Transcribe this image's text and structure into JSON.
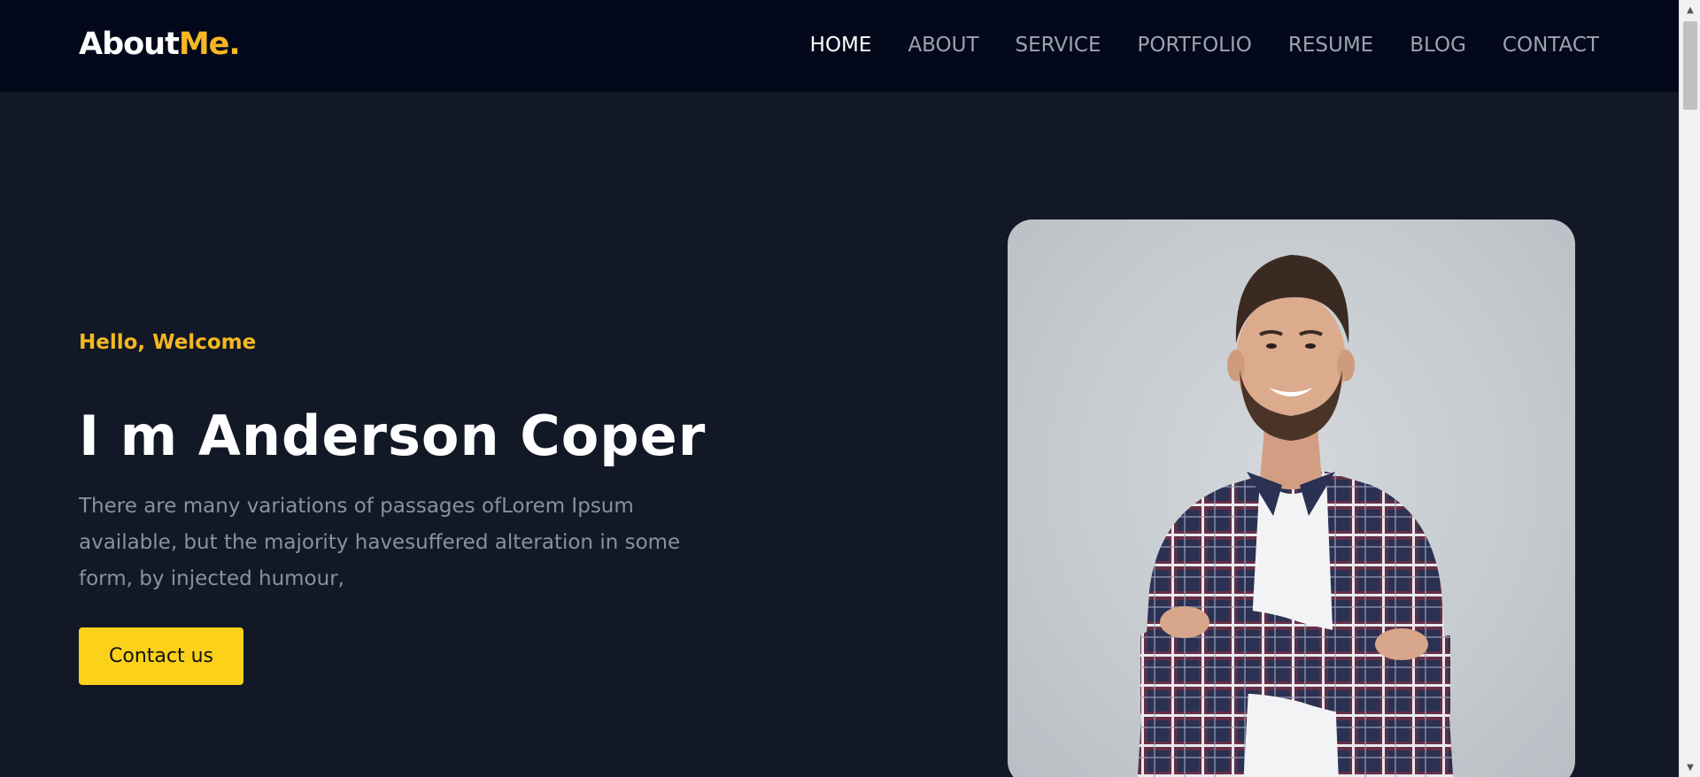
{
  "header": {
    "logo_main": "About",
    "logo_accent": "Me."
  },
  "nav": {
    "items": [
      {
        "label": "HOME",
        "active": true
      },
      {
        "label": "ABOUT"
      },
      {
        "label": "SERVICE"
      },
      {
        "label": "PORTFOLIO"
      },
      {
        "label": "RESUME"
      },
      {
        "label": "BLOG"
      },
      {
        "label": "CONTACT"
      }
    ]
  },
  "hero": {
    "greeting": "Hello, Welcome",
    "title": "I m Anderson Coper",
    "description": "There are many variations of passages ofLorem Ipsum available, but the majority havesuffered alteration in some form, by injected humour,",
    "cta_label": "Contact us"
  },
  "colors": {
    "background": "#121826",
    "navbar": "#03081a",
    "accent": "#f5b822",
    "button": "#fcd11a",
    "muted_text": "#8a90a0"
  }
}
